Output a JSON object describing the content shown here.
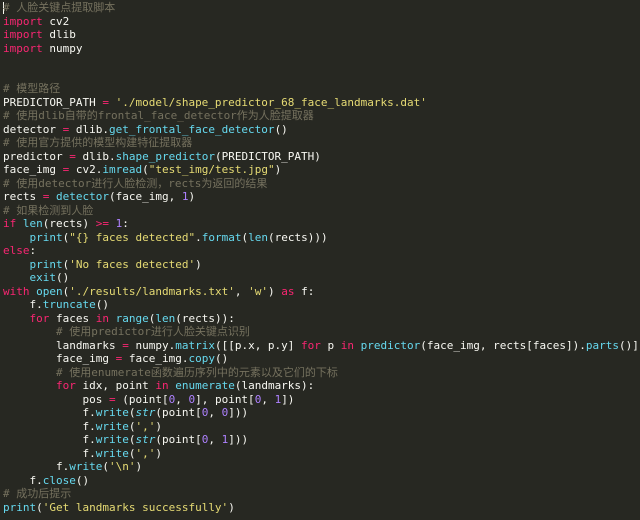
{
  "editor": {
    "language": "python",
    "theme": {
      "background": "#272822",
      "text": "#f8f8f2",
      "comment": "#75715e",
      "keyword": "#f92672",
      "string": "#e6db74",
      "function": "#66d9ef",
      "number": "#ae81ff"
    },
    "lines": [
      [
        [
          "cmt",
          "# 人脸关键点提取脚本"
        ]
      ],
      [
        [
          "kw",
          "import"
        ],
        [
          "txt",
          " cv2"
        ]
      ],
      [
        [
          "kw",
          "import"
        ],
        [
          "txt",
          " dlib"
        ]
      ],
      [
        [
          "kw",
          "import"
        ],
        [
          "txt",
          " numpy"
        ]
      ],
      [],
      [],
      [
        [
          "cmt",
          "# 模型路径"
        ]
      ],
      [
        [
          "txt",
          "PREDICTOR_PATH "
        ],
        [
          "kw",
          "="
        ],
        [
          "txt",
          " "
        ],
        [
          "str",
          "'./model/shape_predictor_68_face_landmarks.dat'"
        ]
      ],
      [
        [
          "cmt",
          "# 使用dlib自带的frontal_face_detector作为人脸提取器"
        ]
      ],
      [
        [
          "txt",
          "detector "
        ],
        [
          "kw",
          "="
        ],
        [
          "txt",
          " dlib."
        ],
        [
          "fn",
          "get_frontal_face_detector"
        ],
        [
          "txt",
          "()"
        ]
      ],
      [
        [
          "cmt",
          "# 使用官方提供的模型构建特征提取器"
        ]
      ],
      [
        [
          "txt",
          "predictor "
        ],
        [
          "kw",
          "="
        ],
        [
          "txt",
          " dlib."
        ],
        [
          "fn",
          "shape_predictor"
        ],
        [
          "txt",
          "(PREDICTOR_PATH)"
        ]
      ],
      [
        [
          "txt",
          "face_img "
        ],
        [
          "kw",
          "="
        ],
        [
          "txt",
          " cv2."
        ],
        [
          "fn",
          "imread"
        ],
        [
          "txt",
          "("
        ],
        [
          "str",
          "\"test_img/test.jpg\""
        ],
        [
          "txt",
          ")"
        ]
      ],
      [
        [
          "cmt",
          "# 使用detector进行人脸检测，rects为返回的结果"
        ]
      ],
      [
        [
          "txt",
          "rects "
        ],
        [
          "kw",
          "="
        ],
        [
          "txt",
          " "
        ],
        [
          "fn",
          "detector"
        ],
        [
          "txt",
          "(face_img, "
        ],
        [
          "num",
          "1"
        ],
        [
          "txt",
          ")"
        ]
      ],
      [
        [
          "cmt",
          "# 如果检测到人脸"
        ]
      ],
      [
        [
          "kw",
          "if"
        ],
        [
          "txt",
          " "
        ],
        [
          "fn",
          "len"
        ],
        [
          "txt",
          "(rects) "
        ],
        [
          "kw",
          ">="
        ],
        [
          "txt",
          " "
        ],
        [
          "num",
          "1"
        ],
        [
          "txt",
          ":"
        ]
      ],
      [
        [
          "txt",
          "    "
        ],
        [
          "fn",
          "print"
        ],
        [
          "txt",
          "("
        ],
        [
          "str",
          "\"{} faces detected\""
        ],
        [
          "txt",
          "."
        ],
        [
          "fn",
          "format"
        ],
        [
          "txt",
          "("
        ],
        [
          "fn",
          "len"
        ],
        [
          "txt",
          "(rects)))"
        ]
      ],
      [
        [
          "kw",
          "else"
        ],
        [
          "txt",
          ":"
        ]
      ],
      [
        [
          "txt",
          "    "
        ],
        [
          "fn",
          "print"
        ],
        [
          "txt",
          "("
        ],
        [
          "str",
          "'No faces detected'"
        ],
        [
          "txt",
          ")"
        ]
      ],
      [
        [
          "txt",
          "    "
        ],
        [
          "fn",
          "exit"
        ],
        [
          "txt",
          "()"
        ]
      ],
      [
        [
          "kw",
          "with"
        ],
        [
          "txt",
          " "
        ],
        [
          "fn",
          "open"
        ],
        [
          "txt",
          "("
        ],
        [
          "str",
          "'./results/landmarks.txt'"
        ],
        [
          "txt",
          ", "
        ],
        [
          "str",
          "'w'"
        ],
        [
          "txt",
          ") "
        ],
        [
          "kw",
          "as"
        ],
        [
          "txt",
          " f:"
        ]
      ],
      [
        [
          "txt",
          "    f."
        ],
        [
          "fn",
          "truncate"
        ],
        [
          "txt",
          "()"
        ]
      ],
      [
        [
          "txt",
          "    "
        ],
        [
          "kw",
          "for"
        ],
        [
          "txt",
          " faces "
        ],
        [
          "kw",
          "in"
        ],
        [
          "txt",
          " "
        ],
        [
          "fn",
          "range"
        ],
        [
          "txt",
          "("
        ],
        [
          "fn",
          "len"
        ],
        [
          "txt",
          "(rects)):"
        ]
      ],
      [
        [
          "txt",
          "        "
        ],
        [
          "cmt",
          "# 使用predictor进行人脸关键点识别"
        ]
      ],
      [
        [
          "txt",
          "        landmarks "
        ],
        [
          "kw",
          "="
        ],
        [
          "txt",
          " numpy."
        ],
        [
          "fn",
          "matrix"
        ],
        [
          "txt",
          "([[p.x, p.y] "
        ],
        [
          "kw",
          "for"
        ],
        [
          "txt",
          " p "
        ],
        [
          "kw",
          "in"
        ],
        [
          "txt",
          " "
        ],
        [
          "fn",
          "predictor"
        ],
        [
          "txt",
          "(face_img, rects[faces])."
        ],
        [
          "fn",
          "parts"
        ],
        [
          "txt",
          "()])"
        ]
      ],
      [
        [
          "txt",
          "        face_img "
        ],
        [
          "kw",
          "="
        ],
        [
          "txt",
          " face_img."
        ],
        [
          "fn",
          "copy"
        ],
        [
          "txt",
          "()"
        ]
      ],
      [
        [
          "txt",
          "        "
        ],
        [
          "cmt",
          "# 使用enumerate函数遍历序列中的元素以及它们的下标"
        ]
      ],
      [
        [
          "txt",
          "        "
        ],
        [
          "kw",
          "for"
        ],
        [
          "txt",
          " idx, point "
        ],
        [
          "kw",
          "in"
        ],
        [
          "txt",
          " "
        ],
        [
          "fn",
          "enumerate"
        ],
        [
          "txt",
          "(landmarks):"
        ]
      ],
      [
        [
          "txt",
          "            pos "
        ],
        [
          "kw",
          "="
        ],
        [
          "txt",
          " (point["
        ],
        [
          "num",
          "0"
        ],
        [
          "txt",
          ", "
        ],
        [
          "num",
          "0"
        ],
        [
          "txt",
          "], point["
        ],
        [
          "num",
          "0"
        ],
        [
          "txt",
          ", "
        ],
        [
          "num",
          "1"
        ],
        [
          "txt",
          "])"
        ]
      ],
      [
        [
          "txt",
          "            f."
        ],
        [
          "fn",
          "write"
        ],
        [
          "txt",
          "("
        ],
        [
          "bi",
          "str"
        ],
        [
          "txt",
          "(point["
        ],
        [
          "num",
          "0"
        ],
        [
          "txt",
          ", "
        ],
        [
          "num",
          "0"
        ],
        [
          "txt",
          "]))"
        ]
      ],
      [
        [
          "txt",
          "            f."
        ],
        [
          "fn",
          "write"
        ],
        [
          "txt",
          "("
        ],
        [
          "str",
          "','"
        ],
        [
          "txt",
          ")"
        ]
      ],
      [
        [
          "txt",
          "            f."
        ],
        [
          "fn",
          "write"
        ],
        [
          "txt",
          "("
        ],
        [
          "bi",
          "str"
        ],
        [
          "txt",
          "(point["
        ],
        [
          "num",
          "0"
        ],
        [
          "txt",
          ", "
        ],
        [
          "num",
          "1"
        ],
        [
          "txt",
          "]))"
        ]
      ],
      [
        [
          "txt",
          "            f."
        ],
        [
          "fn",
          "write"
        ],
        [
          "txt",
          "("
        ],
        [
          "str",
          "','"
        ],
        [
          "txt",
          ")"
        ]
      ],
      [
        [
          "txt",
          "        f."
        ],
        [
          "fn",
          "write"
        ],
        [
          "txt",
          "("
        ],
        [
          "str",
          "'\\n'"
        ],
        [
          "txt",
          ")"
        ]
      ],
      [
        [
          "txt",
          "    f."
        ],
        [
          "fn",
          "close"
        ],
        [
          "txt",
          "()"
        ]
      ],
      [
        [
          "cmt",
          "# 成功后提示"
        ]
      ],
      [
        [
          "fn",
          "print"
        ],
        [
          "txt",
          "("
        ],
        [
          "str",
          "'Get landmarks successfully'"
        ],
        [
          "txt",
          ")"
        ]
      ]
    ]
  }
}
